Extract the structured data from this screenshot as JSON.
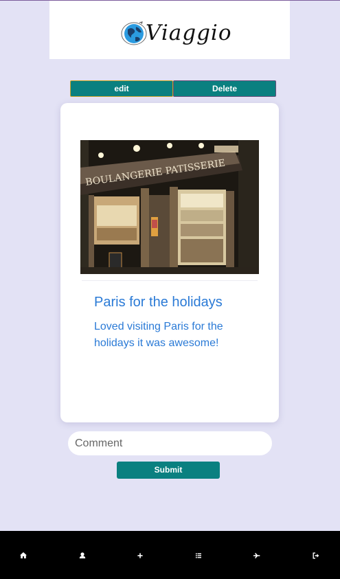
{
  "app": {
    "brand_name": "Viaggio"
  },
  "actions": {
    "edit_label": "edit",
    "delete_label": "Delete"
  },
  "post": {
    "title": "Paris for the holidays",
    "body": "Loved visiting Paris for the holidays it was awesome!",
    "photo_signage": "BOULANGERIE PATISSERIE"
  },
  "comment": {
    "placeholder": "Comment",
    "value": "",
    "submit_label": "Submit"
  },
  "bottom_nav": {
    "items": [
      {
        "icon": "home-icon"
      },
      {
        "icon": "user-icon"
      },
      {
        "icon": "plus-icon"
      },
      {
        "icon": "list-icon"
      },
      {
        "icon": "plane-icon"
      },
      {
        "icon": "logout-icon"
      }
    ]
  },
  "colors": {
    "page_background": "#e3e2f5",
    "button_teal": "#0a8080",
    "post_text_blue": "#2a7ad6",
    "nav_background": "#000000"
  }
}
